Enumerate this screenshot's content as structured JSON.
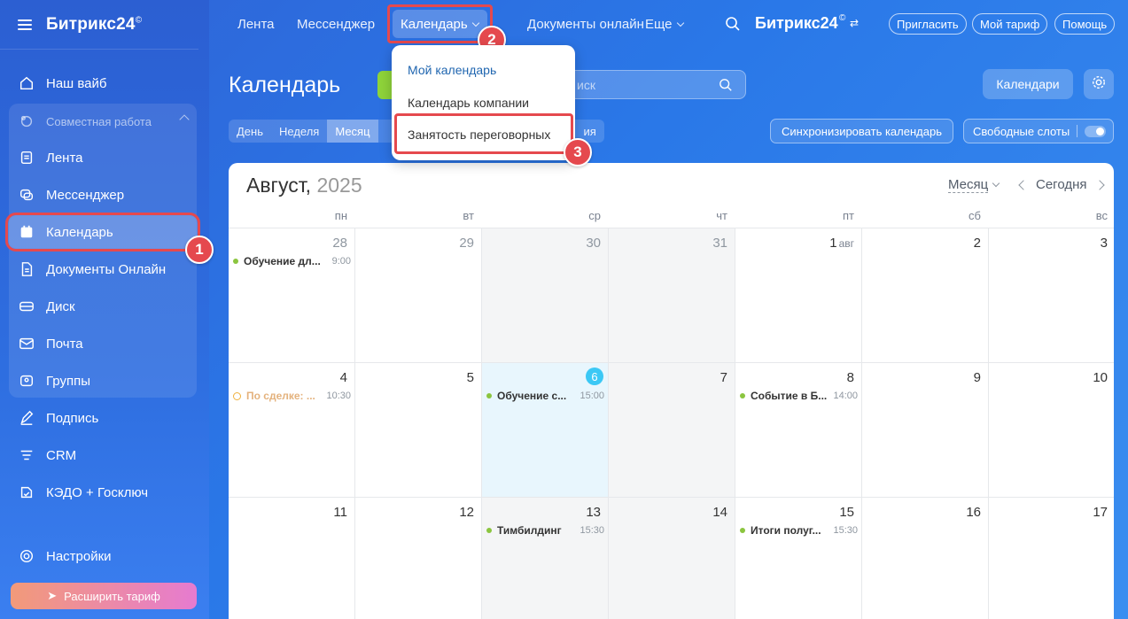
{
  "sidebar": {
    "logo": "Битрикс24",
    "logo_mark": "©",
    "items": [
      {
        "label": "Наш вайб",
        "icon": "home-icon"
      },
      {
        "label": "Совместная работа",
        "icon": "collaboration-icon"
      },
      {
        "label": "Лента",
        "icon": "feed-icon"
      },
      {
        "label": "Мессенджер",
        "icon": "messenger-icon"
      },
      {
        "label": "Календарь",
        "icon": "calendar-icon"
      },
      {
        "label": "Документы Онлайн",
        "icon": "document-icon"
      },
      {
        "label": "Диск",
        "icon": "disk-icon"
      },
      {
        "label": "Почта",
        "icon": "mail-icon"
      },
      {
        "label": "Группы",
        "icon": "groups-icon"
      },
      {
        "label": "Подпись",
        "icon": "signature-icon"
      },
      {
        "label": "CRM",
        "icon": "crm-icon"
      },
      {
        "label": "КЭДО + Госключ",
        "icon": "kedo-icon"
      },
      {
        "label": "Настройки",
        "icon": "gear-icon"
      }
    ],
    "upgrade_label": "Расширить тариф"
  },
  "topnav": {
    "items": [
      "Лента",
      "Мессенджер",
      "Календарь",
      "Документы онлайн",
      "Еще"
    ],
    "logo": "Битрикс24",
    "invite": "Пригласить",
    "tariff": "Мой тариф",
    "help": "Помощь"
  },
  "main": {
    "title": "Календарь",
    "search_placeholder": "иск",
    "calendars_button": "Календари",
    "view_tabs": [
      "День",
      "Неделя",
      "Месяц",
      "ия"
    ],
    "active_view": "Месяц",
    "sync_button": "Синхронизировать календарь",
    "slots_button": "Свободные слоты"
  },
  "dropdown": {
    "items": [
      "Мой календарь",
      "Календарь компании",
      "Занятость переговорных"
    ]
  },
  "annotations": [
    "1",
    "2",
    "3"
  ],
  "calendar": {
    "month": "Август,",
    "year": "2025",
    "mode": "Месяц",
    "today_label": "Сегодня",
    "weekdays": [
      "пн",
      "вт",
      "ср",
      "чт",
      "пт",
      "сб",
      "вс"
    ],
    "weeks": [
      [
        {
          "day": "28",
          "muted": true,
          "event": {
            "title": "Обучение дл...",
            "time": "9:00"
          }
        },
        {
          "day": "29",
          "muted": true
        },
        {
          "day": "30",
          "muted": true,
          "weekend": true
        },
        {
          "day": "31",
          "muted": true,
          "weekend": true
        },
        {
          "day": "1",
          "sub": "авг"
        },
        {
          "day": "2"
        },
        {
          "day": "3"
        }
      ],
      [
        {
          "day": "4",
          "event": {
            "title": "По сделке: ...",
            "time": "10:30",
            "faded": true
          }
        },
        {
          "day": "5"
        },
        {
          "day": "6",
          "today": true,
          "event": {
            "title": "Обучение с...",
            "time": "15:00"
          }
        },
        {
          "day": "7",
          "weekend": true
        },
        {
          "day": "8",
          "event": {
            "title": "Событие в Б...",
            "time": "14:00"
          }
        },
        {
          "day": "9"
        },
        {
          "day": "10"
        }
      ],
      [
        {
          "day": "11"
        },
        {
          "day": "12"
        },
        {
          "day": "13",
          "weekend": true,
          "event": {
            "title": "Тимбилдинг",
            "time": "15:30"
          }
        },
        {
          "day": "14",
          "weekend": true
        },
        {
          "day": "15",
          "event": {
            "title": "Итоги полуг...",
            "time": "15:30"
          }
        },
        {
          "day": "16"
        },
        {
          "day": "17"
        }
      ]
    ]
  },
  "colors": {
    "accent": "#2f6fe0",
    "highlight": "#e5494e",
    "event_dot": "#8bc53f",
    "today": "#3bc8f5"
  }
}
